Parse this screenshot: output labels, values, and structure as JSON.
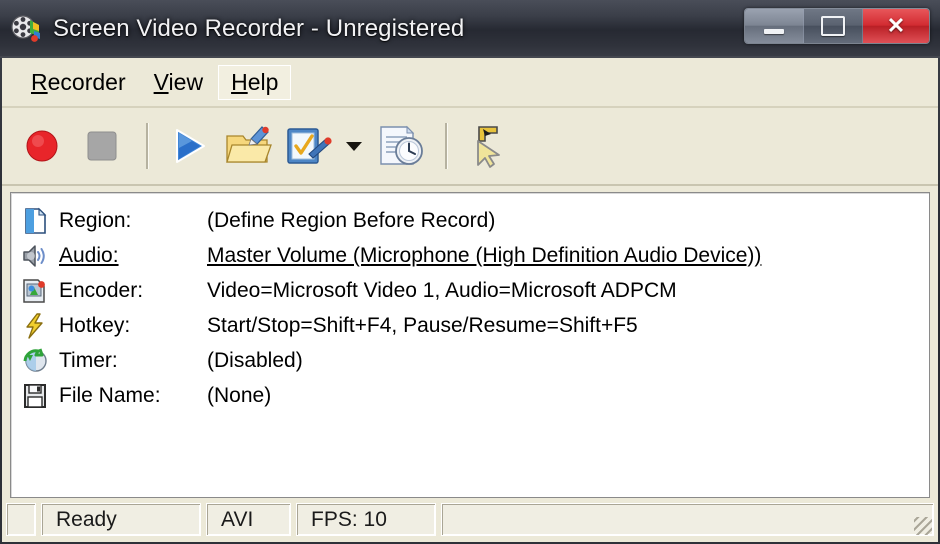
{
  "window": {
    "title": "Screen Video Recorder - Unregistered",
    "app_icon": "film-reel-icon",
    "controls": {
      "minimize": "minimize-icon",
      "maximize": "maximize-icon",
      "close": "✕"
    }
  },
  "menu": {
    "items": [
      {
        "label": "Recorder",
        "mnemonic": "R",
        "focused": false
      },
      {
        "label": "View",
        "mnemonic": "V",
        "focused": false
      },
      {
        "label": "Help",
        "mnemonic": "H",
        "focused": true
      }
    ]
  },
  "toolbar": {
    "buttons": [
      {
        "name": "record-button",
        "icon": "record-circle-icon",
        "title": "Record",
        "enabled": true
      },
      {
        "name": "stop-button",
        "icon": "stop-square-icon",
        "title": "Stop",
        "enabled": false
      },
      {
        "name": "play-button",
        "icon": "play-triangle-icon",
        "title": "Play",
        "enabled": true
      },
      {
        "name": "open-file-button",
        "icon": "open-folder-edit-icon",
        "title": "Open",
        "enabled": true
      },
      {
        "name": "settings-button",
        "icon": "settings-check-icon",
        "title": "Settings",
        "enabled": true
      },
      {
        "name": "settings-dropdown",
        "icon": "chevron-down-icon",
        "title": "Settings menu",
        "enabled": true
      },
      {
        "name": "schedule-button",
        "icon": "document-clock-icon",
        "title": "Timer Schedule",
        "enabled": true
      },
      {
        "name": "select-region-button",
        "icon": "region-cursor-icon",
        "title": "Select Region",
        "enabled": false
      }
    ]
  },
  "info": {
    "rows": [
      {
        "icon": "region-page-icon",
        "label": "Region:",
        "value": "(Define Region Before Record)",
        "link": false
      },
      {
        "icon": "audio-speaker-icon",
        "label": "Audio:",
        "value": "Master Volume (Microphone (High Definition Audio Device))",
        "link": true
      },
      {
        "icon": "encoder-page-icon",
        "label": "Encoder:",
        "value": "Video=Microsoft Video 1, Audio=Microsoft ADPCM",
        "link": false
      },
      {
        "icon": "lightning-icon",
        "label": "Hotkey:",
        "value": "Start/Stop=Shift+F4, Pause/Resume=Shift+F5",
        "link": false
      },
      {
        "icon": "timer-globe-icon",
        "label": "Timer:",
        "value": "(Disabled)",
        "link": false
      },
      {
        "icon": "floppy-disk-icon",
        "label": "File Name:",
        "value": "(None)",
        "link": false
      }
    ]
  },
  "statusbar": {
    "blank": "",
    "state": "Ready",
    "format": "AVI",
    "fps": "FPS: 10",
    "extra": "",
    "grip": "resize-grip-icon"
  },
  "colors": {
    "client_background": "#ece9d8",
    "list_background": "#ffffff",
    "titlebar_dark": "#262932",
    "close_red": "#d22b31",
    "record_red": "#e8252a",
    "play_blue": "#2a6fc9"
  }
}
